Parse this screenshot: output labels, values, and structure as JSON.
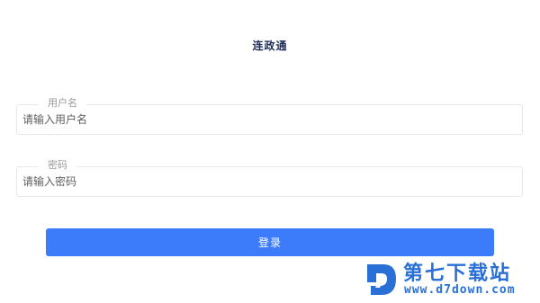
{
  "app": {
    "title": "连政通"
  },
  "form": {
    "username": {
      "legend": "用户名",
      "placeholder": "请输入用户名",
      "value": ""
    },
    "password": {
      "legend": "密码",
      "placeholder": "请输入密码",
      "value": ""
    },
    "login_label": "登录"
  },
  "watermark": {
    "name": "第七下载站",
    "url": "www.d7down.com",
    "logo_icon": "d7-logo-icon",
    "color": "#2a6fd6"
  },
  "colors": {
    "accent": "#3c7cfb",
    "title": "#1f2d5a",
    "border": "#e8e8e8"
  }
}
